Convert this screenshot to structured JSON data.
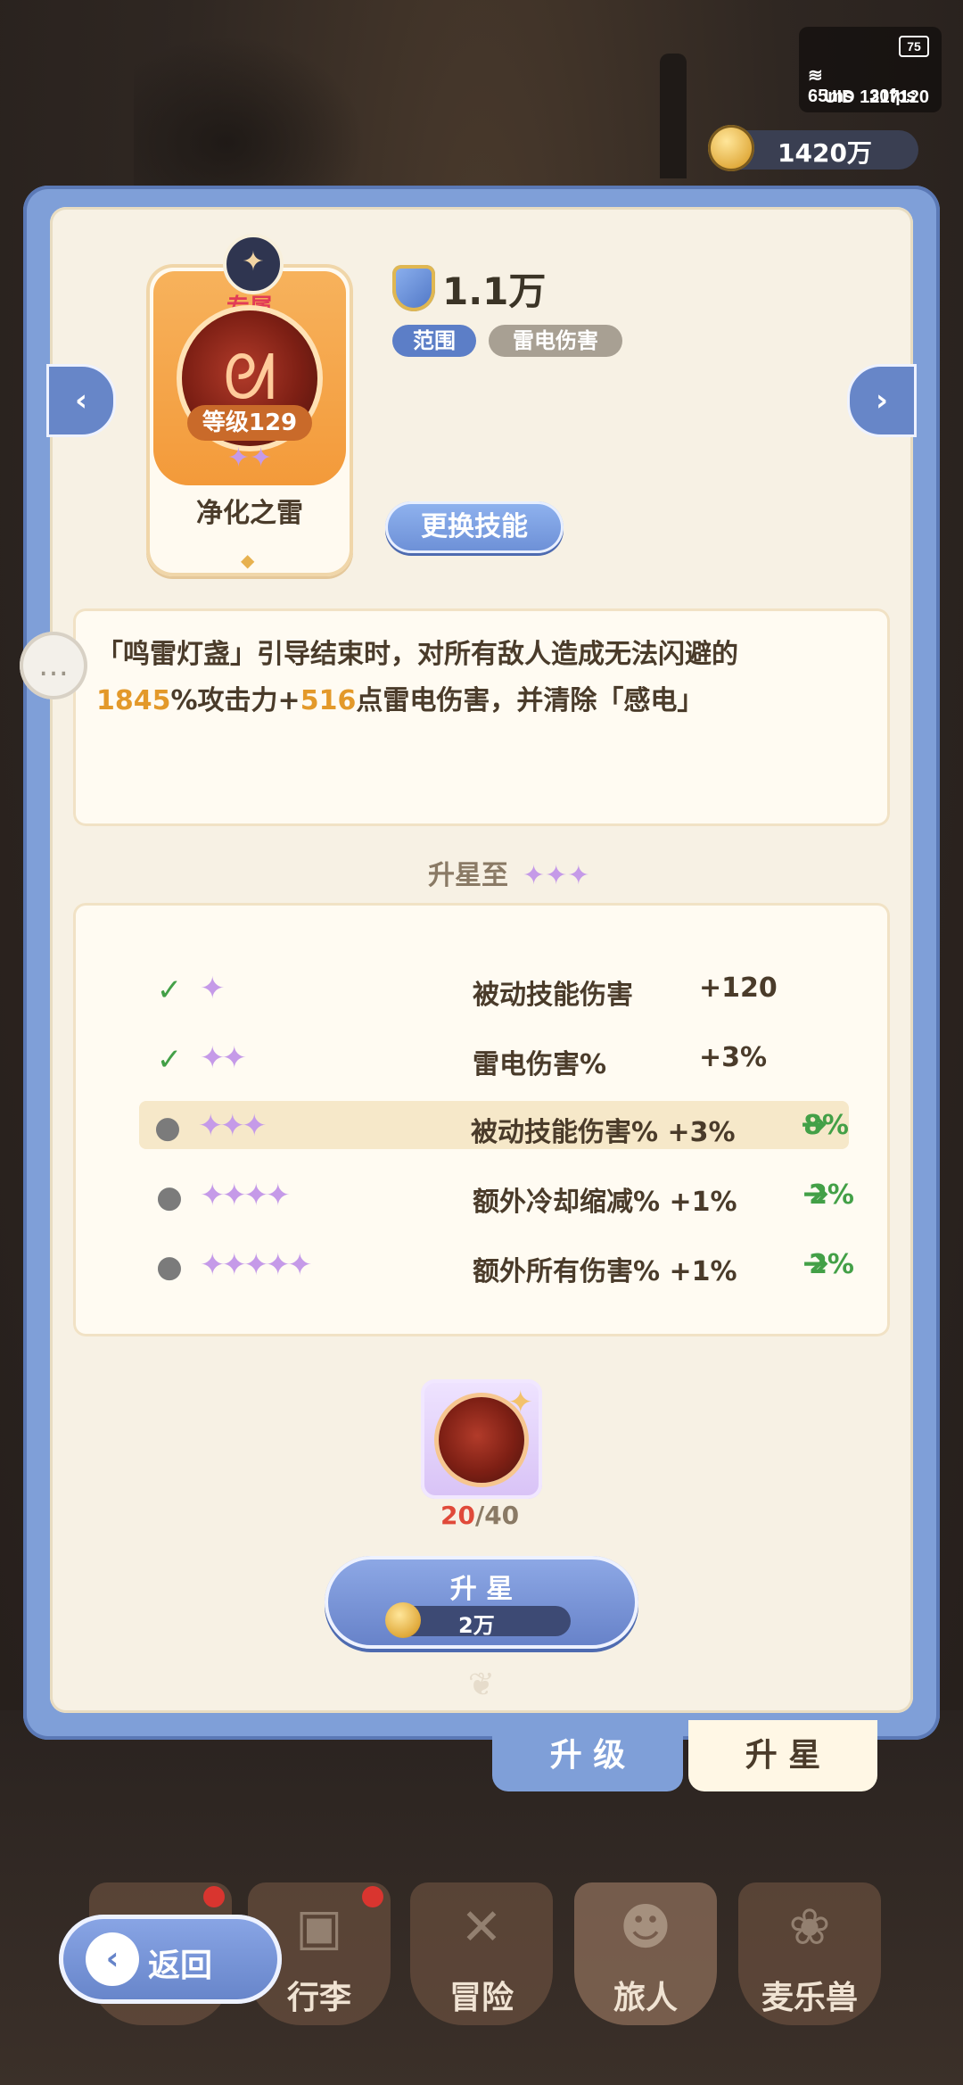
{
  "status": {
    "battery": "75",
    "ping": "65ms",
    "fps": "30fps",
    "uid": "UID  1217120"
  },
  "currency": {
    "gold": "1420万"
  },
  "skill": {
    "badge": "专属",
    "level": "等级129",
    "name": "净化之雷",
    "power": "1.1万",
    "tags": [
      "范围",
      "雷电伤害"
    ],
    "change_button": "更换技能",
    "desc_1": "「鸣雷灯盏」引导结束时，对所有敌人造成无法闪避的",
    "desc_val1": "1845",
    "desc_2": "%攻击力+",
    "desc_val2": "516",
    "desc_3": "点雷电伤害，并清除「感电」"
  },
  "upgrade": {
    "title": "升星至",
    "rows": [
      {
        "stars": "✦",
        "label": "被动技能伤害",
        "value": "+120",
        "result": ""
      },
      {
        "stars": "✦✦",
        "label": "雷电伤害%",
        "value": "+3%",
        "result": ""
      },
      {
        "stars": "✦✦✦",
        "label": "被动技能伤害% +3%",
        "value": "",
        "result": "8%"
      },
      {
        "stars": "✦✦✦✦",
        "label": "额外冷却缩减% +1%",
        "value": "",
        "result": "2%"
      },
      {
        "stars": "✦✦✦✦✦",
        "label": "额外所有伤害% +1%",
        "value": "",
        "result": "2%"
      }
    ]
  },
  "material": {
    "current": "20",
    "sep": "/",
    "max": "40"
  },
  "star_button": {
    "label": "升 星",
    "cost": "2万"
  },
  "tabs": {
    "upgrade": "升 级",
    "star": "升 星"
  },
  "nav": {
    "back": "返回",
    "items": [
      "行李",
      "冒险",
      "旅人",
      "麦乐兽"
    ]
  }
}
